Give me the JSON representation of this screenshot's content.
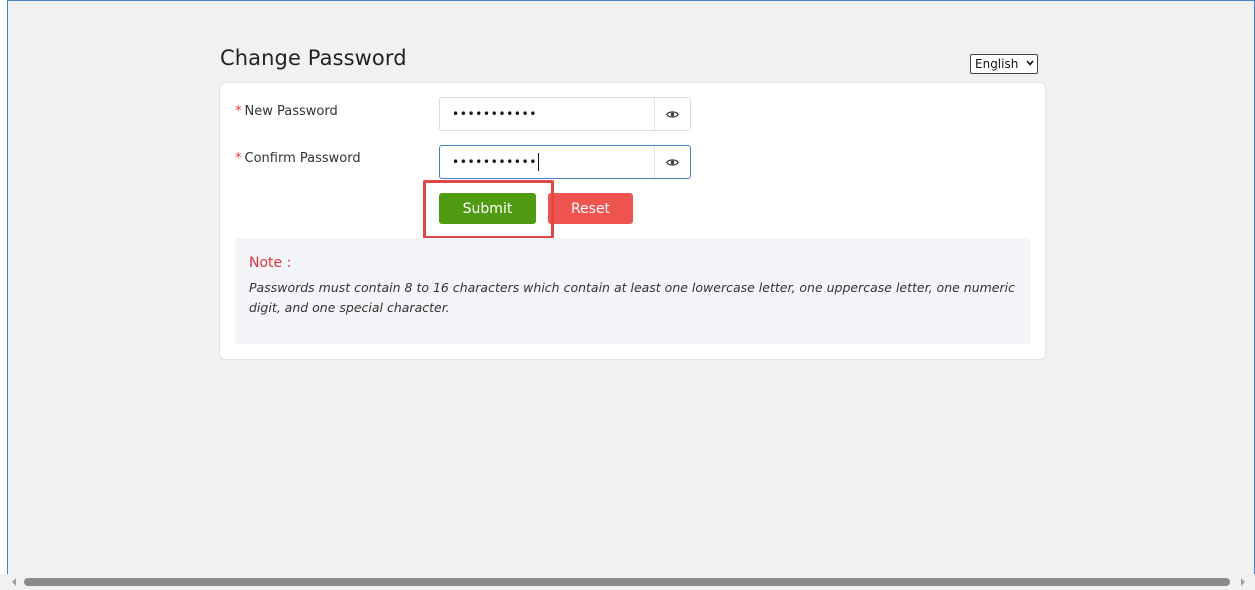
{
  "page": {
    "title": "Change Password"
  },
  "language": {
    "selected": "English",
    "icon": "chevron-down-icon"
  },
  "form": {
    "new_password": {
      "label": "New Password",
      "required_mark": "*",
      "masked_value": "•••••••••••",
      "icon": "eye-icon"
    },
    "confirm_password": {
      "label": "Confirm Password",
      "required_mark": "*",
      "masked_value": "•••••••••••",
      "icon": "eye-icon",
      "focused": true
    },
    "submit_label": "Submit",
    "reset_label": "Reset"
  },
  "note": {
    "title": "Note :",
    "text": "Passwords must contain 8 to 16 characters which contain at least one lowercase letter, one uppercase letter, one numeric digit, and one special character."
  },
  "colors": {
    "submit": "#4f9b12",
    "reset": "#f05450",
    "required": "#e0353a",
    "note_title": "#d9363e",
    "highlight": "#e04848",
    "frame_border": "#4a7fc8"
  }
}
